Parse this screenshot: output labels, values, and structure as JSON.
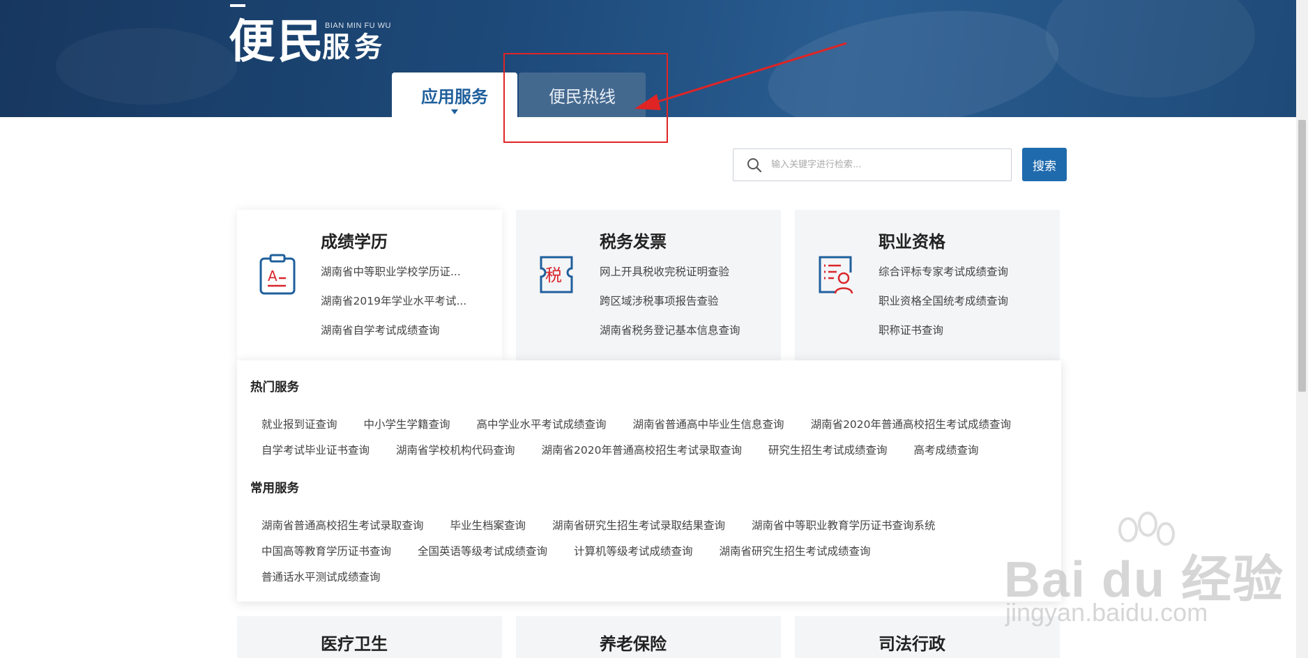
{
  "brand": {
    "title": "便民",
    "subtitle": "服务",
    "pinyin": "BIAN MIN FU WU"
  },
  "tabs": [
    {
      "label": "应用服务",
      "active": true
    },
    {
      "label": "便民热线",
      "active": false
    }
  ],
  "search": {
    "placeholder": "输入关键字进行检索...",
    "button_label": "搜索"
  },
  "categories": [
    {
      "title": "成绩学历",
      "icon": "certificate-icon",
      "links": [
        "湖南省中等职业学校学历证...",
        "湖南省2019年学业水平考试...",
        "湖南省自学考试成绩查询"
      ]
    },
    {
      "title": "税务发票",
      "icon": "tax-ticket-icon",
      "links": [
        "网上开具税收完税证明查验",
        "跨区域涉税事项报告查验",
        "湖南省税务登记基本信息查询"
      ]
    },
    {
      "title": "职业资格",
      "icon": "qualification-icon",
      "links": [
        "综合评标专家考试成绩查询",
        "职业资格全国统考成绩查询",
        "职称证书查询"
      ]
    }
  ],
  "categories_row2": [
    "医疗卫生",
    "养老保险",
    "司法行政"
  ],
  "panel": {
    "hot_title": "热门服务",
    "hot_row1": [
      "就业报到证查询",
      "中小学生学籍查询",
      "高中学业水平考试成绩查询",
      "湖南省普通高中毕业生信息查询",
      "湖南省2020年普通高校招生考试成绩查询"
    ],
    "hot_row2": [
      "自学考试毕业证书查询",
      "湖南省学校机构代码查询",
      "湖南省2020年普通高校招生考试录取查询",
      "研究生招生考试成绩查询",
      "高考成绩查询"
    ],
    "common_title": "常用服务",
    "common_row1": [
      "湖南省普通高校招生考试录取查询",
      "毕业生档案查询",
      "湖南省研究生招生考试录取结果查询",
      "湖南省中等职业教育学历证书查询系统"
    ],
    "common_row2": [
      "中国高等教育学历证书查询",
      "全国英语等级考试成绩查询",
      "计算机等级考试成绩查询",
      "湖南省研究生招生考试成绩查询"
    ],
    "common_row3": [
      "普通话水平测试成绩查询"
    ]
  },
  "watermark": {
    "main": "Bai du 经验",
    "url": "jingyan.baidu.com"
  },
  "colors": {
    "banner": "#1d4a7a",
    "accent": "#1f6aad",
    "annotation": "#e02424",
    "icon_red": "#d9262b",
    "icon_blue": "#1f5f9c"
  }
}
